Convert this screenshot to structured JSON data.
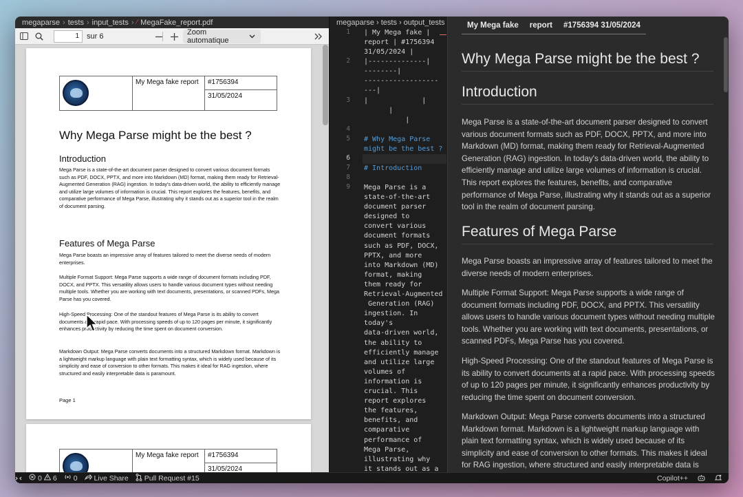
{
  "pdf_viewer": {
    "breadcrumb": [
      "megaparse",
      "tests",
      "input_tests",
      "MegaFake_report.pdf"
    ],
    "toolbar": {
      "page_value": "1",
      "page_of": "sur 6",
      "zoom": "Zoom automatique"
    },
    "page1": {
      "header": {
        "report_name": "My Mega fake report",
        "report_id": "#1756394",
        "date": "31/05/2024"
      },
      "title": "Why Mega Parse might be the best ?",
      "intro_heading": "Introduction",
      "intro_text": "Mega Parse is a state-of-the-art document parser designed to convert various document formats such as PDF, DOCX, PPTX, and more into Markdown (MD) format, making them ready for Retrieval-Augmented Generation (RAG) ingestion. In today's data-driven world, the ability to efficiently manage and utilize large volumes of information is crucial. This report explores the features, benefits, and comparative performance of Mega Parse, illustrating why it stands out as a superior tool in the realm of document parsing.",
      "features_heading": "Features of Mega Parse",
      "features_intro": "Mega Parse boasts an impressive array of features tailored to meet the diverse needs of modern enterprises.",
      "feature_1": "Multiple Format Support: Mega Parse supports a wide range of document formats including PDF, DOCX, and PPTX. This versatility allows users to handle various document types without needing multiple tools. Whether you are working with text documents, presentations, or scanned PDFs, Mega Parse has you covered.",
      "feature_2": "High-Speed Processing: One of the standout features of Mega Parse is its ability to convert documents at a rapid pace. With processing speeds of up to 120 pages per minute, it significantly enhances productivity by reducing the time spent on document conversion.",
      "feature_3": "Markdown Output: Mega Parse converts documents into a structured Markdown format. Markdown is a lightweight markup language with plain text formatting syntax, which is widely used because of its simplicity and ease of conversion to other formats. This makes it ideal for RAG ingestion, where structured and easily interpretable data is paramount.",
      "footer": "Page 1"
    },
    "page2": {
      "report_name": "My Mega fake report",
      "report_id": "#1756394",
      "date": "31/05/2024"
    }
  },
  "editor": {
    "breadcrumb": [
      "megaparse",
      "tests",
      "output_tests"
    ],
    "line_numbers": [
      "1",
      "2",
      "3",
      "4",
      "5",
      "6",
      "7",
      "8",
      "9"
    ],
    "lines": [
      "| My Mega fake |",
      "report | #1756394",
      "31/05/2024 |",
      "|--------------|",
      "--------|",
      "------------------",
      "---|",
      "|             |",
      "      |",
      "          |",
      "# Why Mega Parse",
      "might be the best ?",
      "# Introduction",
      "Mega Parse is a",
      "state-of-the-art",
      "document parser",
      "designed to",
      "convert various",
      "document formats",
      "such as PDF, DOCX,",
      "PPTX, and more",
      "into Markdown (MD)",
      "format, making",
      "them ready for",
      "Retrieval-Augmented",
      " Generation (RAG)",
      "ingestion. In",
      "today's",
      "data-driven world,",
      "the ability to",
      "efficiently manage",
      "and utilize large",
      "volumes of",
      "information is",
      "crucial. This",
      "report explores",
      "the features,",
      "benefits, and",
      "comparative",
      "performance of",
      "Mega Parse,",
      "illustrating why",
      "it stands out as a"
    ]
  },
  "preview": {
    "table_header": [
      "My Mega fake",
      "report",
      "#1756394 31/05/2024"
    ],
    "title": "Why Mega Parse might be the best ?",
    "intro_heading": "Introduction",
    "intro_text": "Mega Parse is a state-of-the-art document parser designed to convert various document formats such as PDF, DOCX, PPTX, and more into Markdown (MD) format, making them ready for Retrieval-Augmented Generation (RAG) ingestion. In today's data-driven world, the ability to efficiently manage and utilize large volumes of information is crucial. This report explores the features, benefits, and comparative performance of Mega Parse, illustrating why it stands out as a superior tool in the realm of document parsing.",
    "features_heading": "Features of Mega Parse",
    "features_intro": "Mega Parse boasts an impressive array of features tailored to meet the diverse needs of modern enterprises.",
    "feature_1": "Multiple Format Support: Mega Parse supports a wide range of document formats including PDF, DOCX, and PPTX. This versatility allows users to handle various document types without needing multiple tools. Whether you are working with text documents, presentations, or scanned PDFs, Mega Parse has you covered.",
    "feature_2": "High-Speed Processing: One of the standout features of Mega Parse is its ability to convert documents at a rapid pace. With processing speeds of up to 120 pages per minute, it significantly enhances productivity by reducing the time spent on document conversion.",
    "feature_3": "Markdown Output: Mega Parse converts documents into a structured Markdown format. Markdown is a lightweight markup language with plain text formatting syntax, which is widely used because of its simplicity and ease of conversion to other formats. This makes it ideal for RAG ingestion, where structured and easily interpretable data is"
  },
  "statusbar": {
    "errors": "0",
    "warnings": "6",
    "ports": "0",
    "live_share": "Live Share",
    "pull_request": "Pull Request #15",
    "copilot": "Copilot++"
  }
}
